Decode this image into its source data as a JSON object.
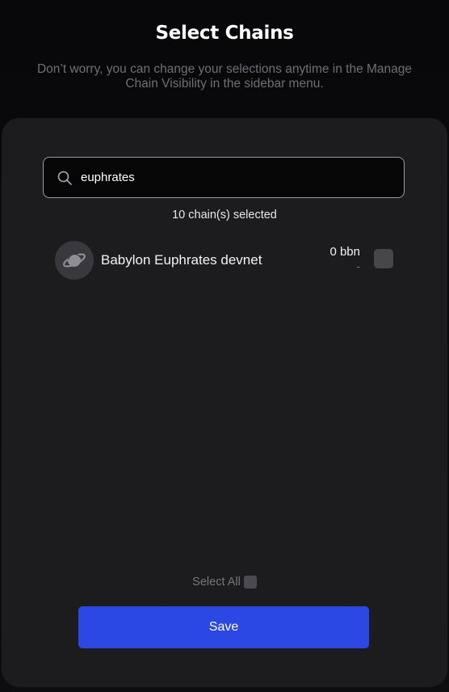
{
  "header": {
    "title": "Select Chains",
    "subtitle": "Don’t worry, you can change your selections anytime in the Manage Chain Visibility in the sidebar menu."
  },
  "search": {
    "value": "euphrates",
    "icon": "search-icon"
  },
  "selection": {
    "count_text": "10 chain(s) selected"
  },
  "chains": [
    {
      "name": "Babylon Euphrates devnet",
      "balance": "0 bbn",
      "usd_value": "-",
      "icon": "planet-icon",
      "checked": false
    }
  ],
  "footer": {
    "select_all_label": "Select All",
    "save_label": "Save"
  },
  "colors": {
    "accent": "#2c48e4",
    "panel": "#1c1c1f",
    "background": "#0a0a0b"
  }
}
